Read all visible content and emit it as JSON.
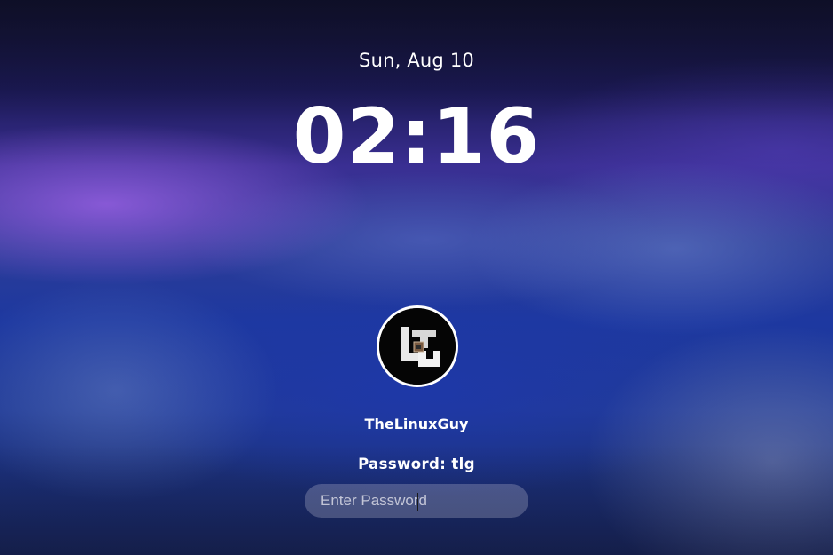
{
  "lock_screen": {
    "date": "Sun, Aug 10",
    "time": "02:16",
    "avatar_icon": "tlg-logo-avatar",
    "username": "TheLinuxGuy",
    "password_hint": "Password: tlg",
    "password_field": {
      "placeholder": "Enter Password",
      "value": ""
    }
  }
}
